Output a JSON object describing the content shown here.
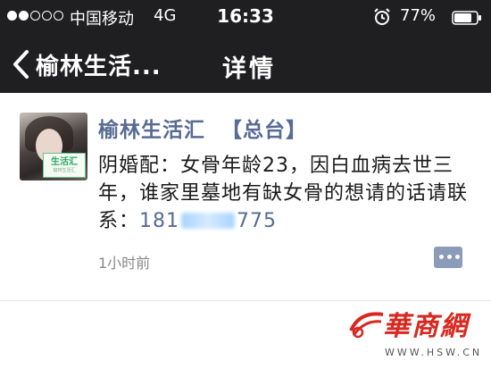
{
  "status_bar": {
    "carrier": "中国移动",
    "network": "4G",
    "time": "16:33",
    "battery": "77%",
    "signal_dots": 5,
    "signal_filled": 2,
    "alarm_icon": "alarm-clock-icon",
    "battery_icon": "battery-icon"
  },
  "nav": {
    "back_label": "榆林生活...",
    "back_icon": "chevron-left-icon",
    "title": "详情"
  },
  "post": {
    "avatar_badge": "生活汇",
    "avatar_badge_sub": "榆林生活汇",
    "author": "榆林生活汇",
    "author_tag": "【总台】",
    "text": "阴婚配：女骨年龄23，因白血病去世三年，谁家里墓地有缺女骨的想请的话请联系：",
    "phone_prefix": "181",
    "phone_suffix": "775",
    "timestamp": "1小时前",
    "comment_icon": "comment-dots-icon"
  },
  "watermark": {
    "brand": "華商網",
    "url": "WWW.HSW.CN"
  },
  "colors": {
    "bar_background": "#1f1f22",
    "link": "#576b95",
    "comment_button": "#8b9cb8",
    "watermark_red": "#d8281f"
  }
}
